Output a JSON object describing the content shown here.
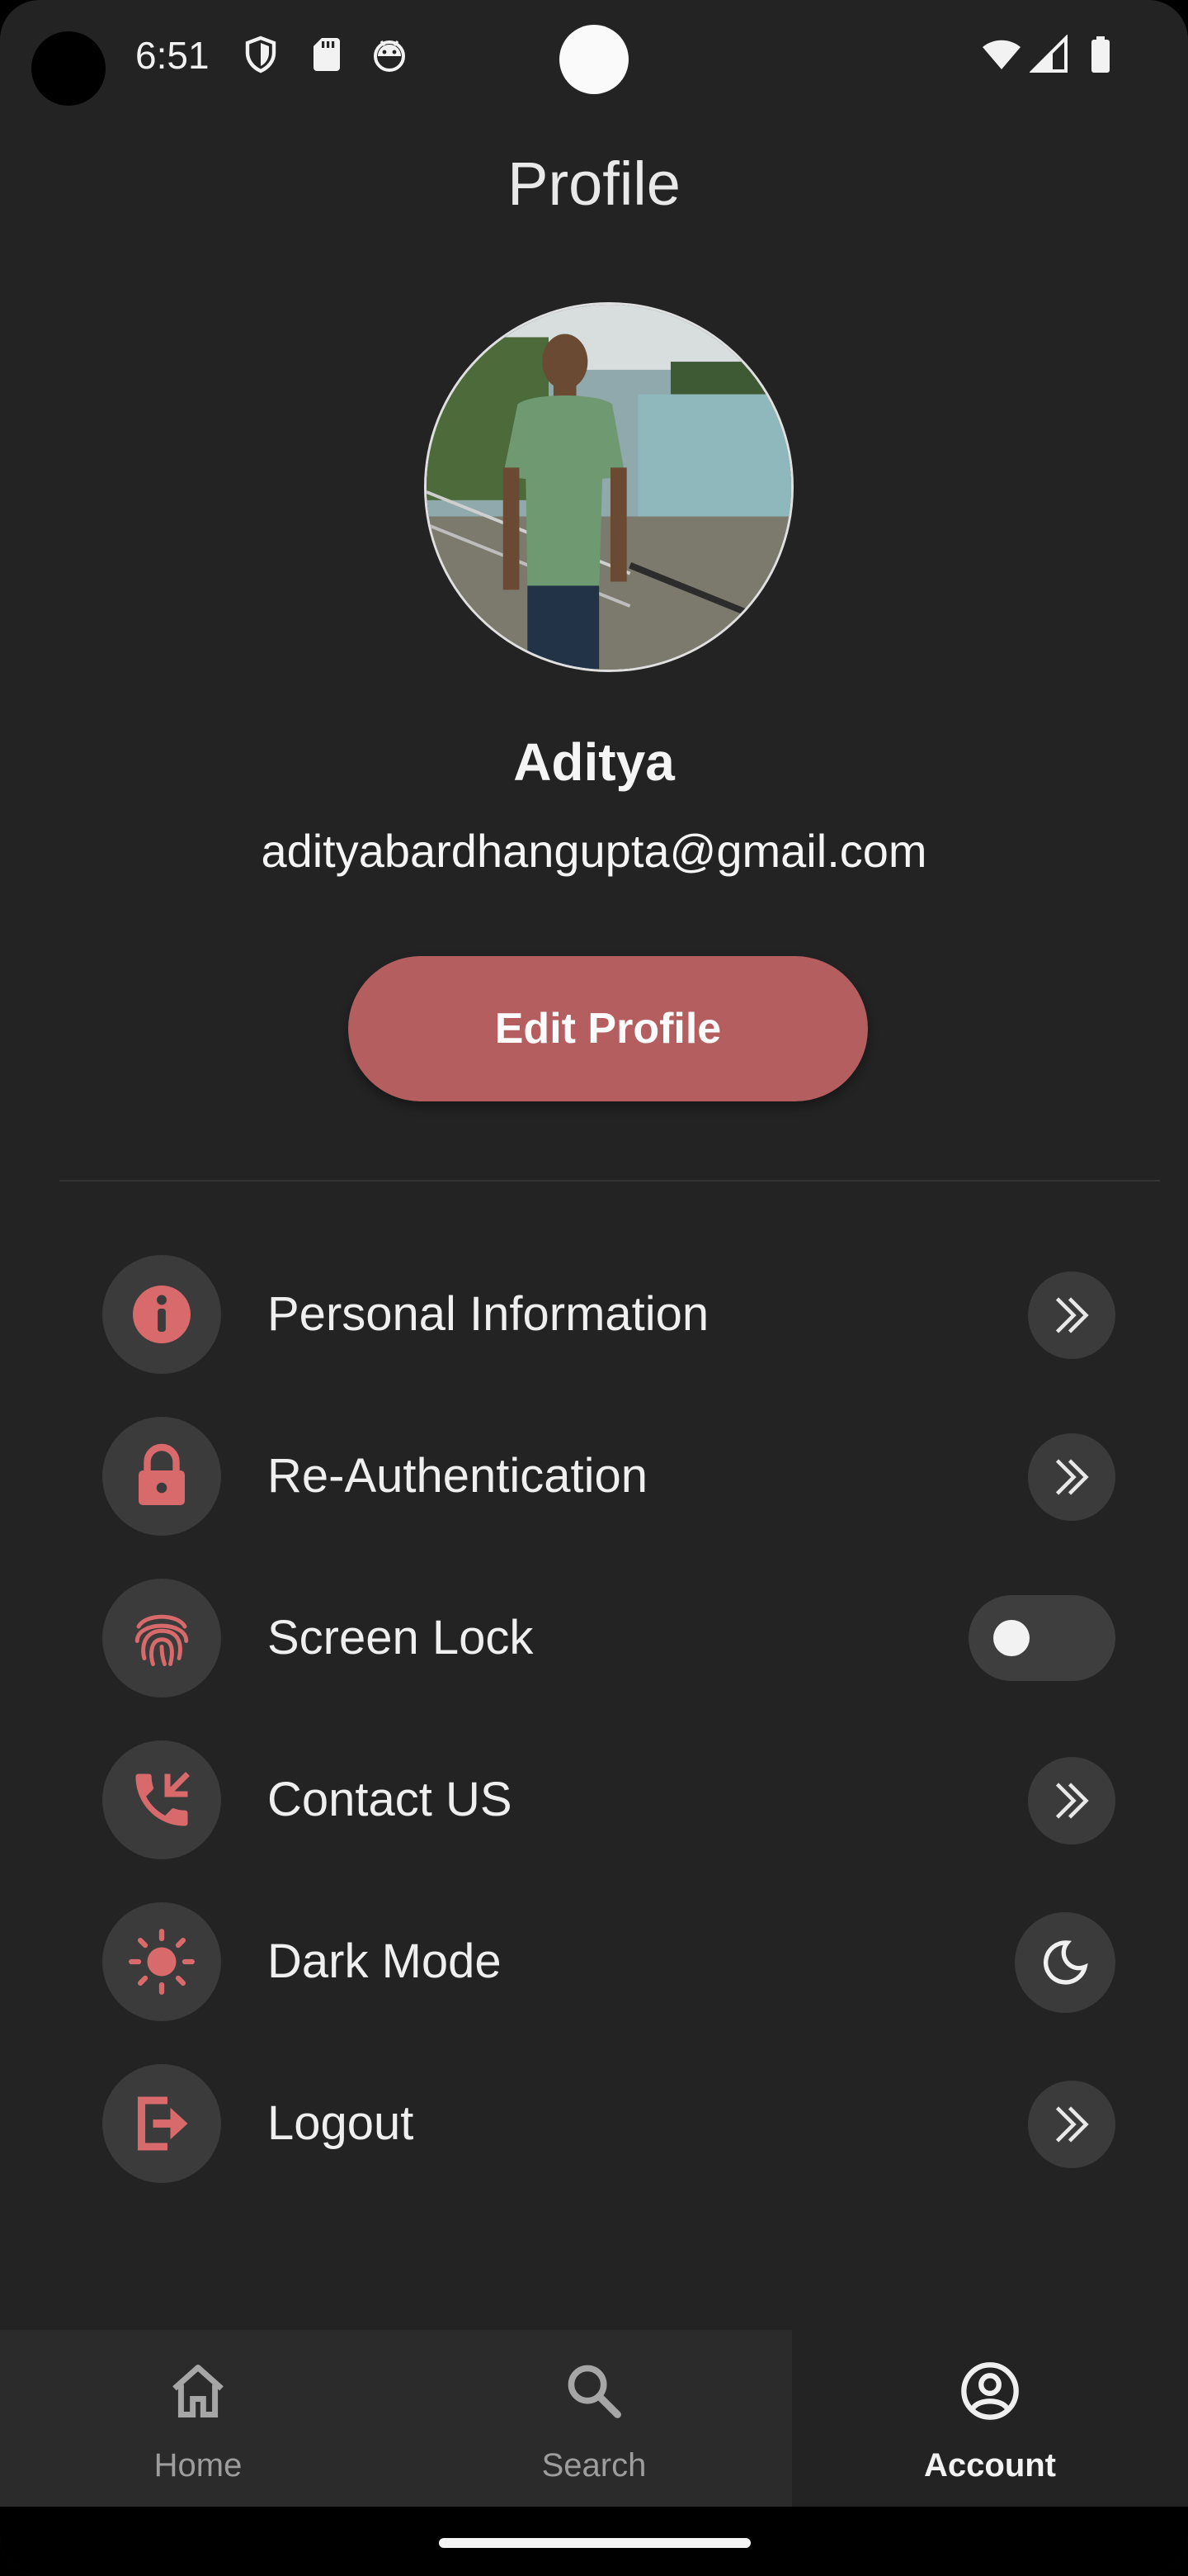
{
  "status_bar": {
    "time": "6:51",
    "left_icons": [
      "shield-icon",
      "sd-card-icon",
      "android-debug-icon"
    ],
    "right_icons": [
      "wifi-icon",
      "cell-signal-icon",
      "battery-icon"
    ]
  },
  "header": {
    "title": "Profile"
  },
  "profile": {
    "name": "Aditya",
    "email": "adityabardhangupta@gmail.com",
    "edit_button_label": "Edit Profile"
  },
  "colors": {
    "background": "#232323",
    "accent": "#b45e60",
    "icon_accent": "#d86a6c",
    "circle_bg": "#3b3b3b",
    "nav_bg": "#2b2b2b"
  },
  "menu": {
    "items": [
      {
        "label": "Personal Information",
        "icon": "info-icon",
        "trailing": "double-chevron-icon"
      },
      {
        "label": "Re-Authentication",
        "icon": "lock-icon",
        "trailing": "double-chevron-icon"
      },
      {
        "label": "Screen Lock",
        "icon": "fingerprint-icon",
        "trailing": "toggle",
        "toggle_on": false
      },
      {
        "label": "Contact US",
        "icon": "phone-icon",
        "trailing": "double-chevron-icon"
      },
      {
        "label": "Dark Mode",
        "icon": "sun-icon",
        "trailing": "moon-icon"
      },
      {
        "label": "Logout",
        "icon": "logout-icon",
        "trailing": "double-chevron-icon"
      }
    ]
  },
  "bottom_nav": {
    "items": [
      {
        "label": "Home",
        "icon": "home-icon",
        "active": false
      },
      {
        "label": "Search",
        "icon": "search-icon",
        "active": false
      },
      {
        "label": "Account",
        "icon": "account-icon",
        "active": true
      }
    ]
  }
}
